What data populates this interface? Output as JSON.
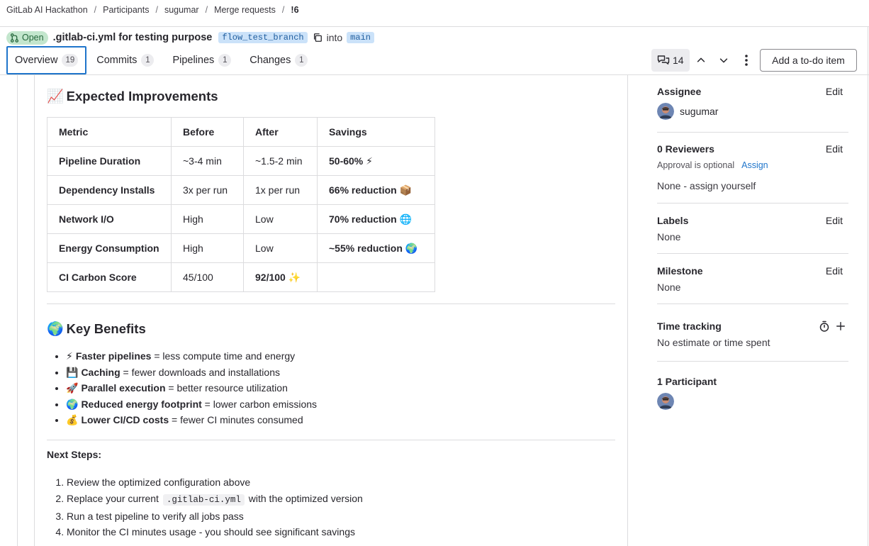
{
  "breadcrumb": [
    "GitLab AI Hackathon",
    "Participants",
    "sugumar",
    "Merge requests",
    "!6"
  ],
  "header": {
    "status": "Open",
    "title": ".gitlab-ci.yml for testing purpose",
    "source_branch": "flow_test_branch",
    "into_label": "into",
    "target_branch": "main"
  },
  "tabs": [
    {
      "label": "Overview",
      "count": "19"
    },
    {
      "label": "Commits",
      "count": "1"
    },
    {
      "label": "Pipelines",
      "count": "1"
    },
    {
      "label": "Changes",
      "count": "1"
    }
  ],
  "actions": {
    "notes_count": "14",
    "todo_label": "Add a to-do item"
  },
  "content": {
    "improvements_emoji": "📈",
    "improvements_title": "Expected Improvements",
    "table_headers": [
      "Metric",
      "Before",
      "After",
      "Savings"
    ],
    "table_rows": [
      [
        "Pipeline Duration",
        "~3-4 min",
        "~1.5-2 min",
        "50-60% ⚡"
      ],
      [
        "Dependency Installs",
        "3x per run",
        "1x per run",
        "66% reduction 📦"
      ],
      [
        "Network I/O",
        "High",
        "Low",
        "70% reduction 🌐"
      ],
      [
        "Energy Consumption",
        "High",
        "Low",
        "~55% reduction 🌍"
      ],
      [
        "CI Carbon Score",
        "45/100",
        "92/100 ✨",
        ""
      ]
    ],
    "benefits_emoji": "🌍",
    "benefits_title": "Key Benefits",
    "benefits": [
      {
        "emoji": "⚡",
        "bold": "Faster pipelines",
        "rest": " = less compute time and energy"
      },
      {
        "emoji": "💾",
        "bold": "Caching",
        "rest": " = fewer downloads and installations"
      },
      {
        "emoji": "🚀",
        "bold": "Parallel execution",
        "rest": " = better resource utilization"
      },
      {
        "emoji": "🌍",
        "bold": "Reduced energy footprint",
        "rest": " = lower carbon emissions"
      },
      {
        "emoji": "💰",
        "bold": "Lower CI/CD costs",
        "rest": " = fewer CI minutes consumed"
      }
    ],
    "next_steps_title": "Next Steps:",
    "steps": {
      "s1": "Review the optimized configuration above",
      "s2_pre": "Replace your current",
      "s2_code": ".gitlab-ci.yml",
      "s2_post": "with the optimized version",
      "s3": "Run a test pipeline to verify all jobs pass",
      "s4": "Monitor the CI minutes usage - you should see significant savings"
    }
  },
  "sidebar": {
    "edit_label": "Edit",
    "assignee_title": "Assignee",
    "assignee_name": "sugumar",
    "reviewers_title": "0 Reviewers",
    "approval_text": "Approval is optional",
    "assign_link": "Assign",
    "reviewers_value": "None - assign yourself",
    "labels_title": "Labels",
    "labels_value": "None",
    "milestone_title": "Milestone",
    "milestone_value": "None",
    "time_title": "Time tracking",
    "time_value": "No estimate or time spent",
    "participants_title": "1 Participant"
  }
}
